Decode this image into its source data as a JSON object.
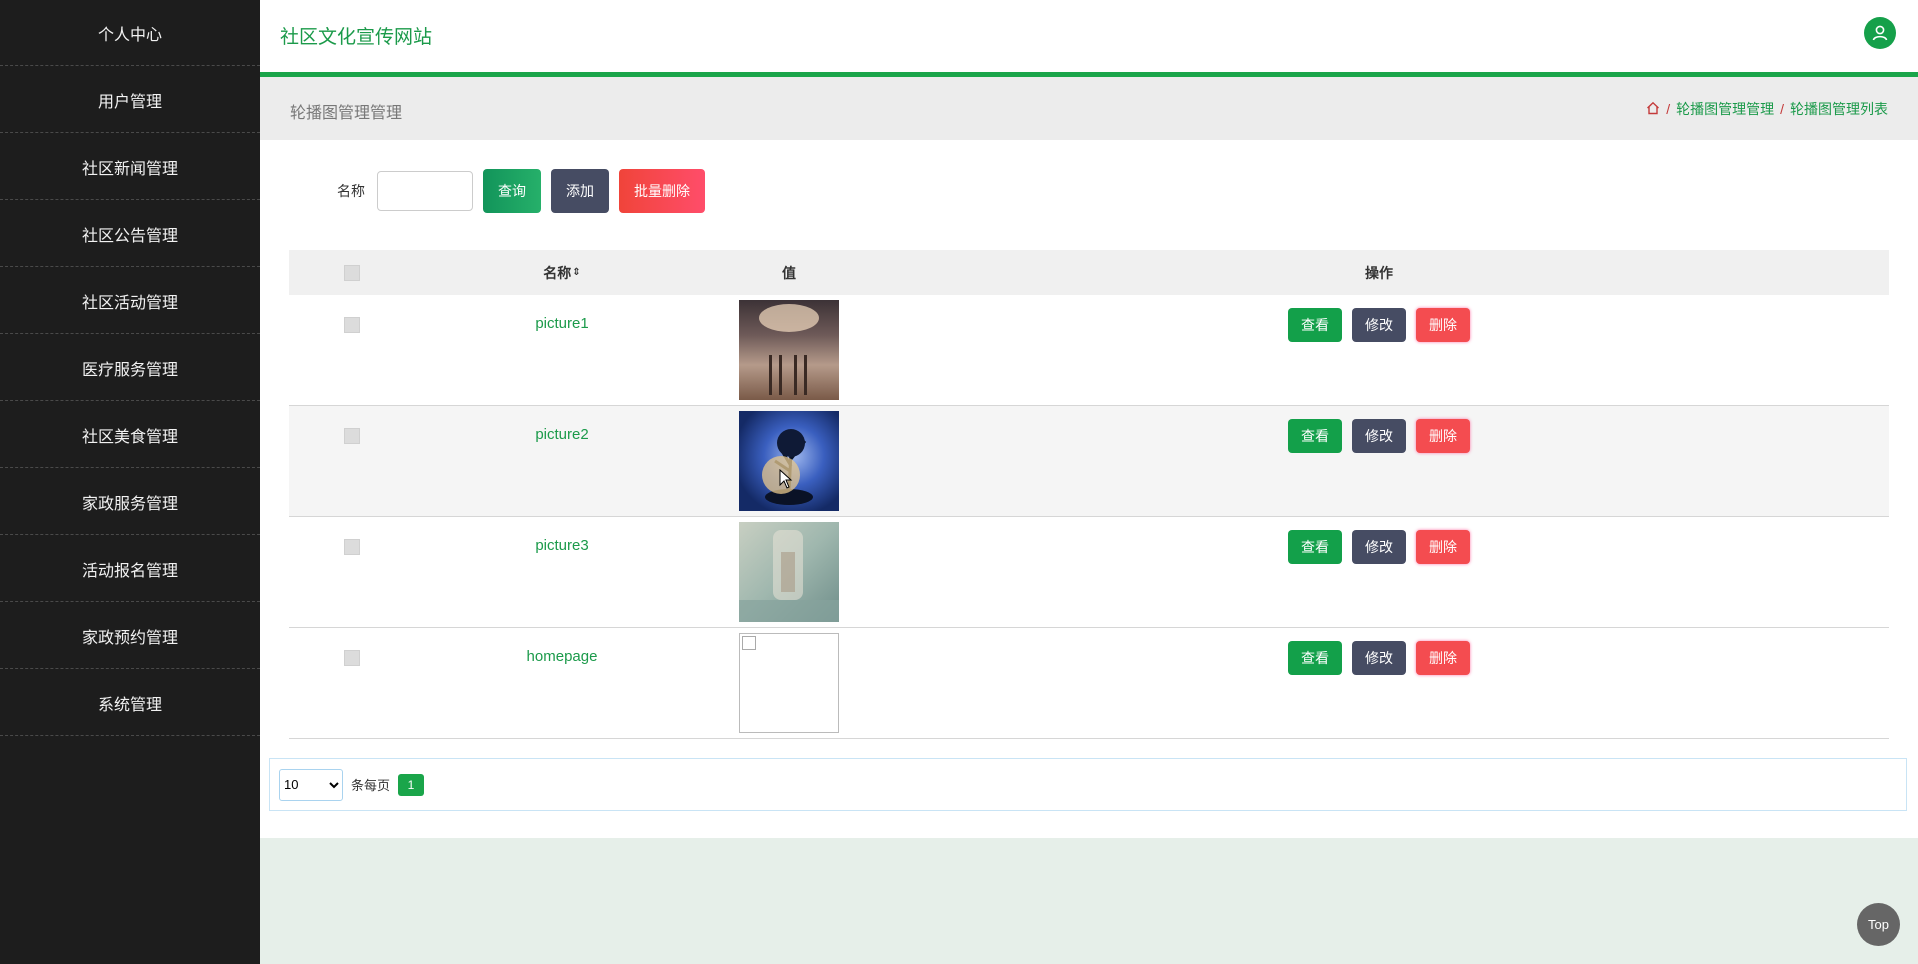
{
  "sidebar": {
    "items": [
      {
        "label": "个人中心"
      },
      {
        "label": "用户管理"
      },
      {
        "label": "社区新闻管理"
      },
      {
        "label": "社区公告管理"
      },
      {
        "label": "社区活动管理"
      },
      {
        "label": "医疗服务管理"
      },
      {
        "label": "社区美食管理"
      },
      {
        "label": "家政服务管理"
      },
      {
        "label": "活动报名管理"
      },
      {
        "label": "家政预约管理"
      },
      {
        "label": "系统管理"
      }
    ]
  },
  "header": {
    "site_title": "社区文化宣传网站",
    "avatar_icon": "user-icon"
  },
  "page": {
    "title": "轮播图管理管理",
    "breadcrumb": [
      {
        "icon": "home-icon"
      },
      {
        "label": "轮播图管理管理"
      },
      {
        "label": "轮播图管理列表"
      }
    ],
    "separator": "/"
  },
  "search": {
    "label": "名称",
    "value": "",
    "placeholder": "",
    "query_label": "查询",
    "add_label": "添加",
    "batch_delete_label": "批量删除"
  },
  "table": {
    "headers": {
      "name": "名称",
      "sort_icon": "sort-icon",
      "value": "值",
      "ops": "操作"
    },
    "rows": [
      {
        "name": "picture1",
        "image": "sunset-pier"
      },
      {
        "name": "picture2",
        "image": "tree-moon"
      },
      {
        "name": "picture3",
        "image": "glass-blur"
      },
      {
        "name": "homepage",
        "image": "broken"
      }
    ],
    "ops": {
      "view": "查看",
      "edit": "修改",
      "delete": "删除"
    }
  },
  "pagination": {
    "page_size": "10",
    "page_size_label": "条每页",
    "current_page": "1"
  },
  "back_to_top": "Top",
  "colors": {
    "brand_green": "#1aa54a",
    "danger": "#f44c50",
    "dark_button": "#464c63",
    "sidebar_bg": "#1d1d1d"
  }
}
